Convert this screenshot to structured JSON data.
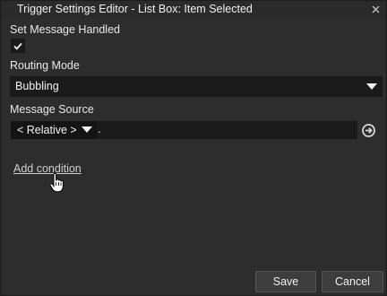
{
  "window": {
    "title": "Trigger Settings Editor - List Box: Item Selected",
    "close_icon": "close-icon"
  },
  "form": {
    "set_message_handled": {
      "label": "Set Message Handled",
      "checked": true
    },
    "routing_mode": {
      "label": "Routing Mode",
      "value": "Bubbling"
    },
    "message_source": {
      "label": "Message Source",
      "relative_value": "< Relative >",
      "path_value": "."
    },
    "add_condition_label": "Add condition"
  },
  "footer": {
    "save_label": "Save",
    "cancel_label": "Cancel"
  },
  "icons": {
    "checkmark": "checkmark-icon",
    "dropdown": "chevron-down-icon",
    "go": "arrow-right-circle-icon",
    "cursor": "hand-pointer-icon"
  },
  "colors": {
    "window_bg": "#2d2d2d",
    "field_bg": "#1b1b1b",
    "button_bg": "#3d3d3d",
    "text": "#e6e6e6"
  }
}
